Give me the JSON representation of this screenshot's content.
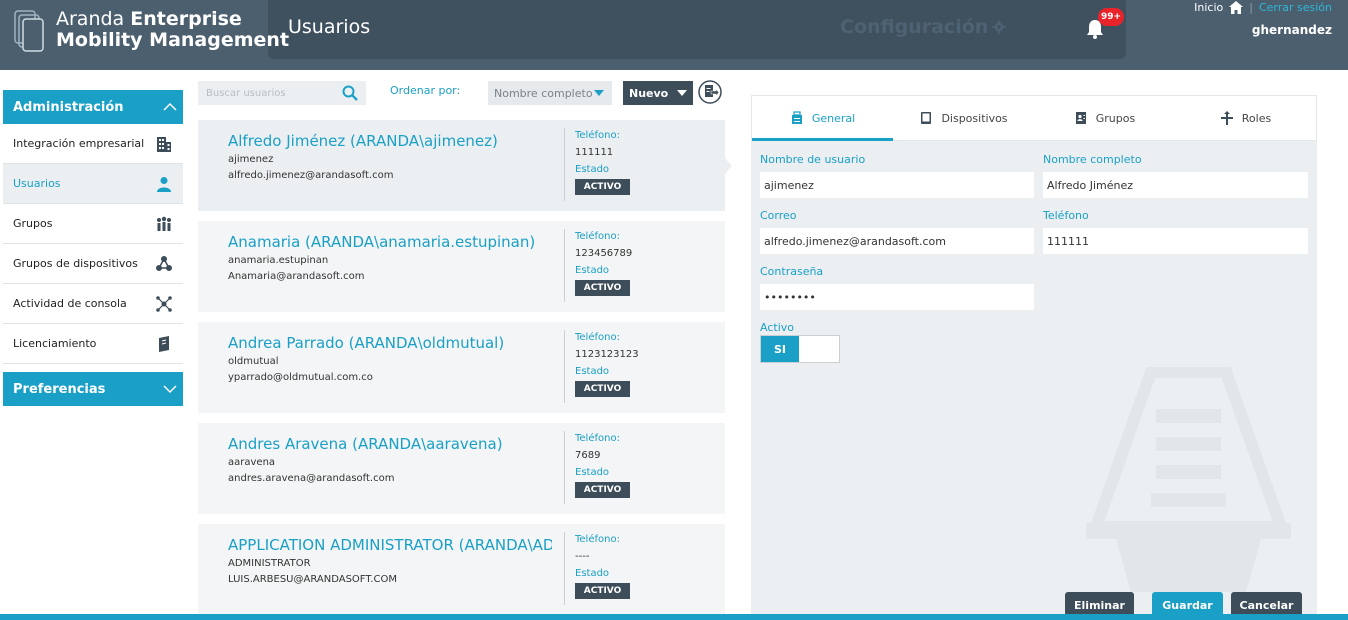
{
  "header": {
    "brand_light": "Aranda",
    "brand_bold_1": "Enterprise",
    "brand_bold_2": "Mobility Management",
    "page_title": "Usuarios",
    "config_title": "Configuración",
    "notification_badge": "99+",
    "home_label": "Inicio",
    "logout_label": "Cerrar sesión",
    "username": "ghernandez"
  },
  "sidebar": {
    "section_admin": "Administración",
    "items": [
      {
        "label": "Integración empresarial",
        "icon": "building-icon"
      },
      {
        "label": "Usuarios",
        "icon": "user-icon",
        "active": true
      },
      {
        "label": "Grupos",
        "icon": "group-icon"
      },
      {
        "label": "Grupos de dispositivos",
        "icon": "device-group-icon"
      },
      {
        "label": "Actividad de consola",
        "icon": "activity-icon"
      },
      {
        "label": "Licenciamiento",
        "icon": "license-icon"
      }
    ],
    "section_prefs": "Preferencias"
  },
  "toolbar": {
    "search_placeholder": "Buscar usuarios",
    "sort_label": "Ordenar por:",
    "sort_value": "Nombre completo",
    "new_label": "Nuevo"
  },
  "users": [
    {
      "name": "Alfredo Jiménez (ARANDA\\ajimenez)",
      "login": "ajimenez",
      "email": "alfredo.jimenez@arandasoft.com",
      "phone_label": "Teléfono:",
      "phone": "111111",
      "state_label": "Estado",
      "state": "ACTIVO"
    },
    {
      "name": "Anamaria (ARANDA\\anamaria.estupinan)",
      "login": "anamaria.estupinan",
      "email": "Anamaria@arandasoft.com",
      "phone_label": "Teléfono:",
      "phone": "123456789",
      "state_label": "Estado",
      "state": "ACTIVO"
    },
    {
      "name": "Andrea Parrado (ARANDA\\oldmutual)",
      "login": "oldmutual",
      "email": "yparrado@oldmutual.com.co",
      "phone_label": "Teléfono:",
      "phone": "1123123123",
      "state_label": "Estado",
      "state": "ACTIVO"
    },
    {
      "name": "Andres Aravena (ARANDA\\aaravena)",
      "login": "aaravena",
      "email": "andres.aravena@arandasoft.com",
      "phone_label": "Teléfono:",
      "phone": "7689",
      "state_label": "Estado",
      "state": "ACTIVO"
    },
    {
      "name": "APPLICATION ADMINISTRATOR (ARANDA\\AD...",
      "login": "ADMINISTRATOR",
      "email": "LUIS.ARBESU@ARANDASOFT.COM",
      "phone_label": "Teléfono:",
      "phone": "----",
      "state_label": "Estado",
      "state": "ACTIVO"
    }
  ],
  "detail": {
    "tabs": {
      "general": "General",
      "devices": "Dispositivos",
      "groups": "Grupos",
      "roles": "Roles"
    },
    "form": {
      "username_label": "Nombre de usuario",
      "username_value": "ajimenez",
      "fullname_label": "Nombre completo",
      "fullname_value": "Alfredo Jiménez",
      "email_label": "Correo",
      "email_value": "alfredo.jimenez@arandasoft.com",
      "phone_label": "Teléfono",
      "phone_value": "111111",
      "password_label": "Contraseña",
      "password_value": "••••••••",
      "active_label": "Activo",
      "active_value": "SI"
    },
    "buttons": {
      "delete": "Eliminar",
      "save": "Guardar",
      "cancel": "Cancelar"
    }
  },
  "colors": {
    "accent": "#1aa0c6",
    "header": "#4c5f6e",
    "dark_button": "#3d4d59"
  }
}
